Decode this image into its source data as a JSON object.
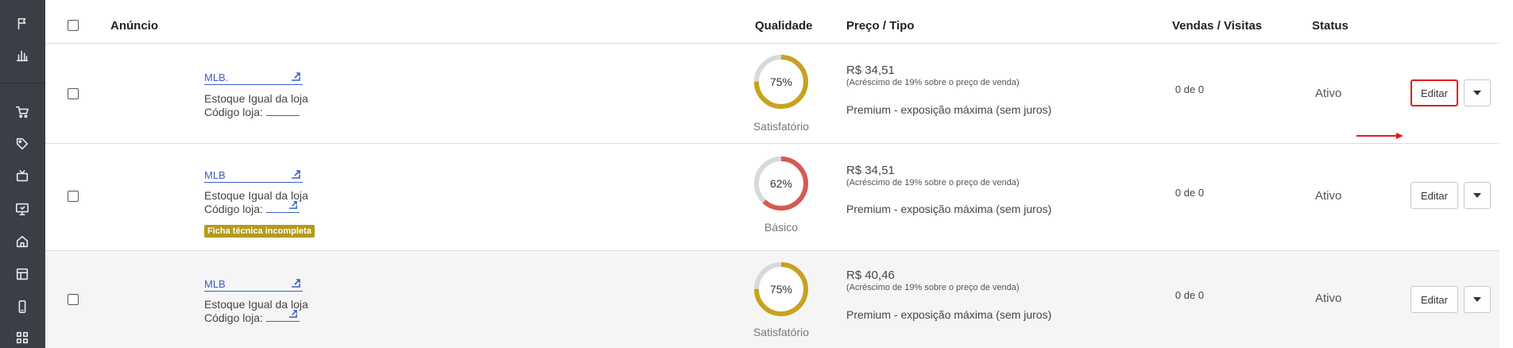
{
  "header": {
    "col_ad": "Anúncio",
    "col_quality": "Qualidade",
    "col_price": "Preço / Tipo",
    "col_sales": "Vendas / Visitas",
    "col_status": "Status"
  },
  "sidebar": {
    "icons": [
      "flag-icon",
      "bar-chart-icon",
      "cart-icon",
      "tag-icon",
      "tv-icon",
      "monitor-icon",
      "home-icon",
      "layout-icon",
      "mobile-icon",
      "grid-icon"
    ]
  },
  "rows": [
    {
      "title": "MLB.",
      "stock": "Estoque Igual da loja",
      "code_label": "Código loja:",
      "tag": "",
      "quality_pct": 75,
      "quality_text": "75%",
      "quality_label": "Satisfatório",
      "quality_color": "#c7a21e",
      "price": "R$ 34,51",
      "price_note": "(Acréscimo de 19% sobre o preço de venda)",
      "type": "Premium - exposição máxima (sem juros)",
      "sales": "0 de 0",
      "status": "Ativo",
      "edit_label": "Editar",
      "highlighted": true
    },
    {
      "title": "MLB",
      "stock": "Estoque Igual da loja",
      "code_label": "Código loja:",
      "tag": "Ficha técnica incompleta",
      "quality_pct": 62,
      "quality_text": "62%",
      "quality_label": "Básico",
      "quality_color": "#d65a52",
      "price": "R$ 34,51",
      "price_note": "(Acréscimo de 19% sobre o preço de venda)",
      "type": "Premium - exposição máxima (sem juros)",
      "sales": "0 de 0",
      "status": "Ativo",
      "edit_label": "Editar",
      "highlighted": false
    },
    {
      "title": "MLB",
      "stock": "Estoque Igual da loja",
      "code_label": "Código loja:",
      "tag": "",
      "quality_pct": 75,
      "quality_text": "75%",
      "quality_label": "Satisfatório",
      "quality_color": "#c7a21e",
      "price": "R$ 40,46",
      "price_note": "(Acréscimo de 19% sobre o preço de venda)",
      "type": "Premium - exposição máxima (sem juros)",
      "sales": "0 de 0",
      "status": "Ativo",
      "edit_label": "Editar",
      "highlighted": false
    }
  ],
  "colors": {
    "link": "#3a5fc4",
    "highlight": "#e31b1b",
    "sidebar": "#3a3f47",
    "tag": "#b59a1a"
  }
}
